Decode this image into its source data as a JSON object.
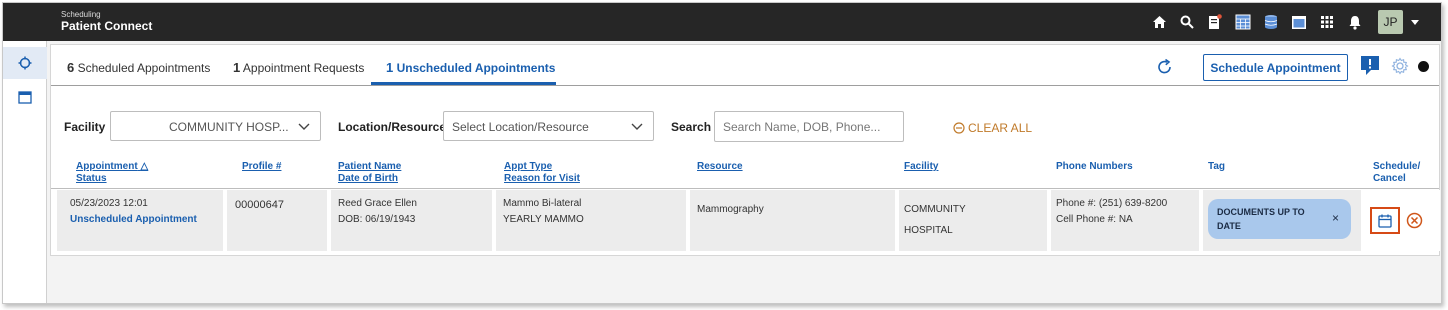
{
  "app": {
    "subtitle": "Scheduling",
    "title": "Patient Connect",
    "user_initials": "JP",
    "accent_color": "#1a5faf"
  },
  "top_icons": [
    "home-icon",
    "search-icon",
    "notes-icon",
    "calendar-grid-icon",
    "database-icon",
    "window-icon",
    "apps-grid-icon",
    "bell-icon"
  ],
  "tabs": [
    {
      "count": "6",
      "label": "Scheduled Appointments",
      "active": false
    },
    {
      "count": "1",
      "label": "Appointment Requests",
      "active": false
    },
    {
      "count": "1",
      "label": "Unscheduled Appointments",
      "active": true
    }
  ],
  "toolbar": {
    "schedule_button": "Schedule Appointment"
  },
  "filters": {
    "facility_label": "Facility",
    "facility_value": "COMMUNITY HOSP...",
    "location_label": "Location/Resource",
    "location_placeholder": "Select Location/Resource",
    "search_label": "Search",
    "search_placeholder": "Search Name, DOB, Phone...",
    "clear_all": "CLEAR ALL"
  },
  "columns": {
    "appointment": "Appointment",
    "status": "Status",
    "profile": "Profile #",
    "patient_name": "Patient Name",
    "dob": "Date of Birth",
    "appt_type": "Appt Type",
    "reason": "Reason for Visit",
    "resource": "Resource",
    "facility": "Facility",
    "phone": "Phone Numbers",
    "tag": "Tag",
    "schedule": "Schedule/",
    "cancel": "Cancel"
  },
  "rows": [
    {
      "datetime": "05/23/2023 12:01",
      "status": "Unscheduled Appointment",
      "profile": "00000647",
      "patient_name": "Reed Grace Ellen",
      "dob": "DOB: 06/19/1943",
      "appt_type": "Mammo Bi-lateral",
      "reason": "YEARLY MAMMO",
      "resource": "Mammography",
      "facility_line1": "COMMUNITY",
      "facility_line2": "HOSPITAL",
      "phone": "Phone #: (251) 639-8200",
      "cell_phone": "Cell Phone #: NA",
      "tag_line1": "DOCUMENTS UP TO",
      "tag_line2": "DATE",
      "tag_close": "×"
    }
  ]
}
